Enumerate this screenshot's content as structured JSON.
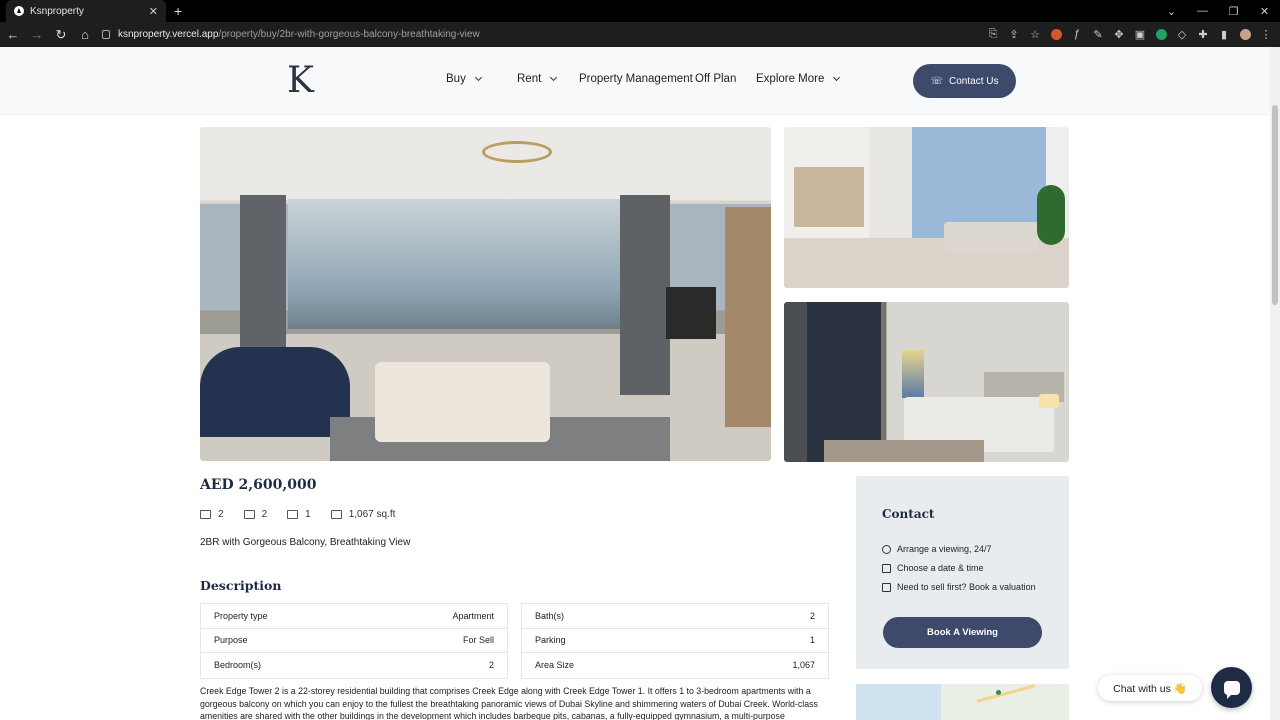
{
  "browser": {
    "tab_title": "Ksnproperty",
    "tab_close": "✕",
    "new_tab": "+",
    "url_host": "ksnproperty.vercel.app",
    "url_path": "/property/buy/2br-with-gorgeous-balcony-breathtaking-view",
    "window_controls": [
      "⌄",
      "—",
      "❐",
      "✕"
    ]
  },
  "header": {
    "logo": "K",
    "nav": [
      {
        "label": "Buy",
        "has_dropdown": true
      },
      {
        "label": "Rent",
        "has_dropdown": true
      },
      {
        "label": "Property Management",
        "has_dropdown": false
      },
      {
        "label": "Off Plan",
        "has_dropdown": false
      },
      {
        "label": "Explore More",
        "has_dropdown": true
      }
    ],
    "contact_button": "Contact Us",
    "accent_color": "#3d4a6b"
  },
  "listing": {
    "price": "AED 2,600,000",
    "specs": [
      {
        "icon": "bed-icon",
        "value": "2"
      },
      {
        "icon": "bath-icon",
        "value": "2"
      },
      {
        "icon": "parking-icon",
        "value": "1"
      },
      {
        "icon": "area-icon",
        "value": "1,067 sq.ft"
      }
    ],
    "subtitle": "2BR with Gorgeous Balcony, Breathtaking View",
    "description_title": "Description",
    "details_left": [
      {
        "label": "Property type",
        "value": "Apartment"
      },
      {
        "label": "Purpose",
        "value": "For Sell"
      },
      {
        "label": "Bedroom(s)",
        "value": "2"
      }
    ],
    "details_right": [
      {
        "label": "Bath(s)",
        "value": "2"
      },
      {
        "label": "Parking",
        "value": "1"
      },
      {
        "label": "Area Size",
        "value": "1,067"
      }
    ],
    "description_text": "Creek Edge Tower 2 is a 22-storey residential building that comprises Creek Edge along with Creek Edge Tower 1. It offers 1 to 3-bedroom apartments with a gorgeous balcony on which you can enjoy to the fullest the breathtaking panoramic views of Dubai Skyline and shimmering waters of Dubai Creek. World-class amenities are shared with the other buildings in the development which includes barbeque pits, cabanas, a fully-equipped gymnasium, a multi-purpose"
  },
  "contact_card": {
    "title": "Contact",
    "lines": [
      {
        "icon": "clock-icon",
        "text": "Arrange a viewing, 24/7"
      },
      {
        "icon": "calendar-icon",
        "text": "Choose a date & time"
      },
      {
        "icon": "home-icon",
        "text": "Need to sell first? Book a valuation"
      }
    ],
    "button": "Book A Viewing"
  },
  "chat": {
    "label": "Chat with us 👋"
  }
}
